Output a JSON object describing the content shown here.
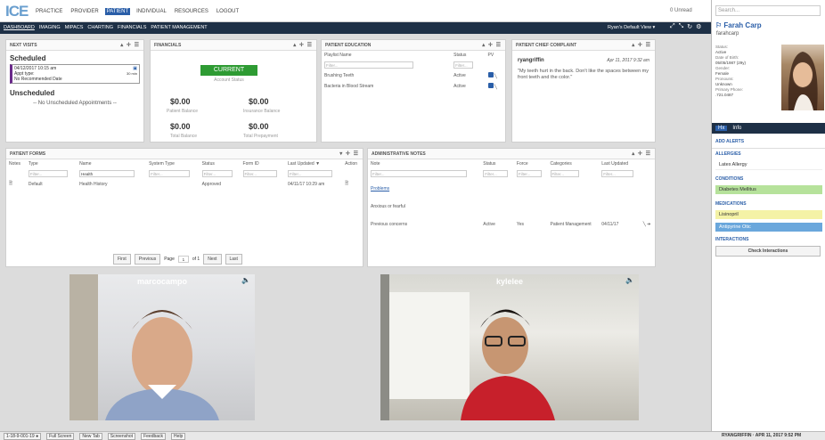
{
  "app": {
    "logo": "ICE",
    "logo_tail": ""
  },
  "topnav": [
    {
      "label": "Practice",
      "active": false
    },
    {
      "label": "Provider",
      "active": false
    },
    {
      "label": "Patient",
      "active": true
    },
    {
      "label": "Individual",
      "active": false
    },
    {
      "label": "Resources",
      "active": false
    },
    {
      "label": "Logout",
      "active": false
    }
  ],
  "unread": "0 Unread",
  "subnav": [
    {
      "label": "Dashboard",
      "active": true
    },
    {
      "label": "Imaging",
      "active": false
    },
    {
      "label": "MIPACS",
      "active": false
    },
    {
      "label": "Charting",
      "active": false
    },
    {
      "label": "Financials",
      "active": false
    },
    {
      "label": "Patient Management",
      "active": false
    }
  ],
  "view_selector": "Ryan's Default View ▾",
  "next_visits": {
    "title": "Next Visits",
    "scheduled": "Scheduled",
    "appt_date": "04/12/2017 10:15 am",
    "appt_type": "Appt type:",
    "appt_note": "No Recommended Date",
    "appt_dur": "30 min",
    "unscheduled": "Unscheduled",
    "unscheduled_msg": "-- No Unscheduled Appointments --"
  },
  "financials": {
    "title": "Financials",
    "status": "CURRENT",
    "status_label": "Account Status",
    "patient_balance": "$0.00",
    "patient_balance_label": "Patient Balance",
    "insurance_balance": "$0.00",
    "insurance_balance_label": "Insurance Balance",
    "total_balance": "$0.00",
    "total_balance_label": "Total Balance",
    "total_prepayment": "$0.00",
    "total_prepayment_label": "Total Prepayment"
  },
  "education": {
    "title": "Patient Education",
    "cols": [
      "Playlist Name",
      "Status",
      "PV"
    ],
    "filter": "Filter...",
    "rows": [
      {
        "name": "Brushing Teeth",
        "status": "Active"
      },
      {
        "name": "Bacteria in Blood Stream",
        "status": "Active"
      }
    ]
  },
  "complaint": {
    "title": "Patient Chief Complaint",
    "user": "ryangriffin",
    "date": "Apr 11, 2017 9:32 am",
    "text": "\"My teeth hurt in the back. Don't like the spaces between my front teeth and the color.\""
  },
  "forms": {
    "title": "Patient Forms",
    "cols": [
      "Notes",
      "Type",
      "Name",
      "System Type",
      "Status",
      "Form ID",
      "Last Updated ▼",
      "Action"
    ],
    "filter": "Filter...",
    "name_filter": "Health",
    "row": {
      "type": "Default",
      "name": "Health History",
      "status": "Approved",
      "updated": "04/11/17 10:29 am"
    },
    "pager": {
      "first": "First",
      "previous": "Previous",
      "page_label": "Page",
      "page": "1",
      "of": "of 1",
      "next": "Next",
      "last": "Last"
    }
  },
  "admin_notes": {
    "title": "Administrative Notes",
    "cols": [
      "Note",
      "Status",
      "Force",
      "Categories",
      "Last Updated"
    ],
    "filter": "Filter...",
    "n1": "Problems",
    "n2": "Anxious or fearful",
    "n3": "Previous concerns",
    "n3_status": "Active",
    "n3_force": "Yes",
    "n3_cat": "Patient Management",
    "n3_date": "04/11/17"
  },
  "video": {
    "left_name": "marcocampo",
    "right_name": "kylelee"
  },
  "sidebar": {
    "search": "Search...",
    "patient_name": "Farah Carp",
    "patient_user": "farahcarp",
    "info": [
      "Status:",
      "Active",
      "Date of Birth:",
      "05/05/1987 (29y)",
      "Gender:",
      "Female",
      "Pronouns:",
      "Unknown",
      "Primary Phone:",
      ".721.0487"
    ],
    "tabs": [
      "Hx",
      "Info"
    ],
    "add_alerts": "ADD ALERTS",
    "allergies_title": "Allergies",
    "allergy": "Latex Allergy",
    "conditions_title": "Conditions",
    "condition": "Diabetes Mellitus",
    "medications_title": "Medications",
    "med1": "Lisinopril",
    "med2": "Antipyrine Otic",
    "interactions_title": "Interactions",
    "check_interactions": "Check Interactions"
  },
  "bottombar": {
    "items": [
      "1-18-9-001-19 ●",
      "Full Screen",
      "New Tab",
      "Screenshot",
      "Feedback",
      "Help"
    ],
    "right": "RYANGRIFFIN · APR 11, 2017 9:52 PM"
  },
  "colors": {
    "accent": "#2a5ea8",
    "current": "#2e9b33",
    "navy": "#1e3046",
    "yellow": "#f4f2a6",
    "green": "#b6e29b",
    "blue": "#6aa7dc"
  }
}
